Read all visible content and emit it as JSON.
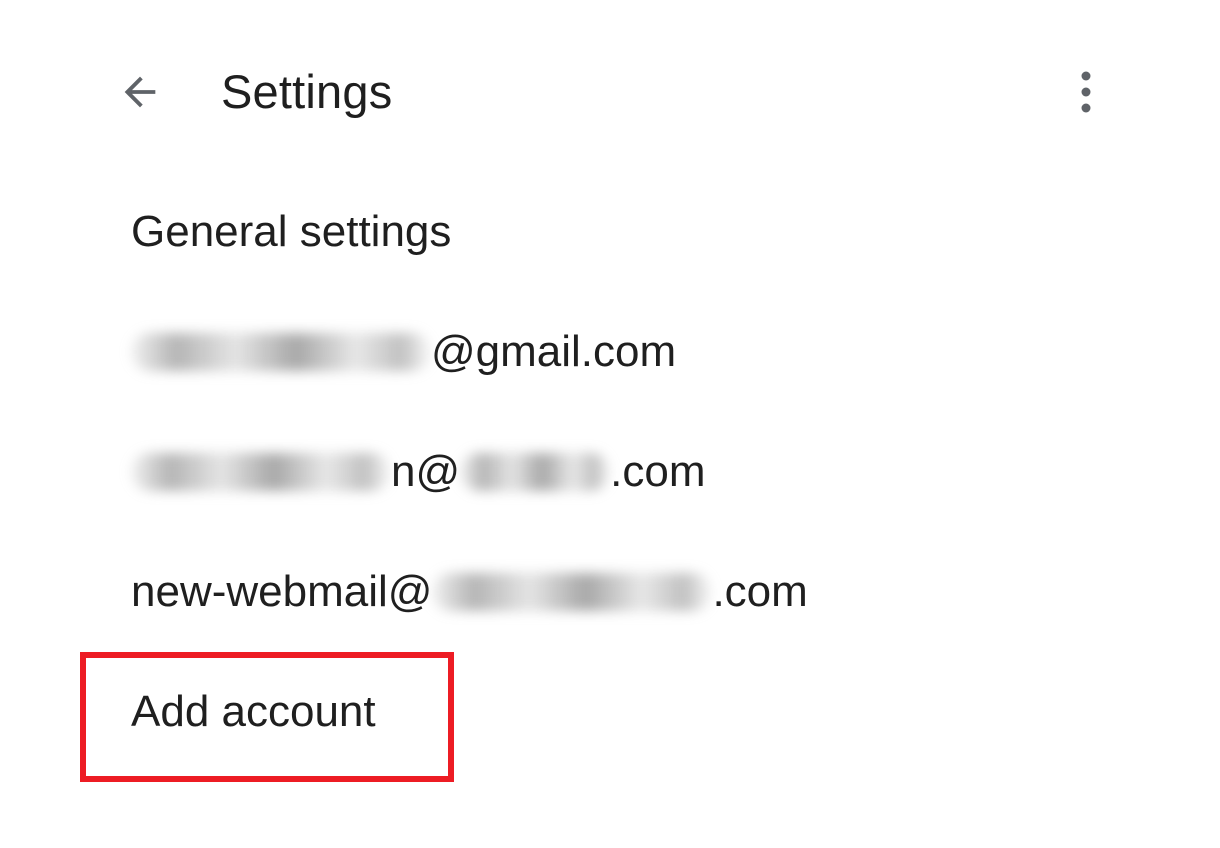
{
  "header": {
    "back_icon": "arrow-back-icon",
    "title": "Settings",
    "more_icon": "more-vert-icon"
  },
  "settings": {
    "general_label": "General settings",
    "accounts": [
      {
        "suffix": "@gmail.com"
      },
      {
        "local_suffix": "n@",
        "suffix": ".com"
      },
      {
        "prefix": "new-webmail@",
        "suffix": ".com"
      }
    ],
    "add_account_label": "Add account"
  },
  "annotation": {
    "highlight_color": "#ed1c24"
  },
  "colors": {
    "text": "#1f1f1f",
    "icon": "#5f6368",
    "background": "#ffffff"
  }
}
